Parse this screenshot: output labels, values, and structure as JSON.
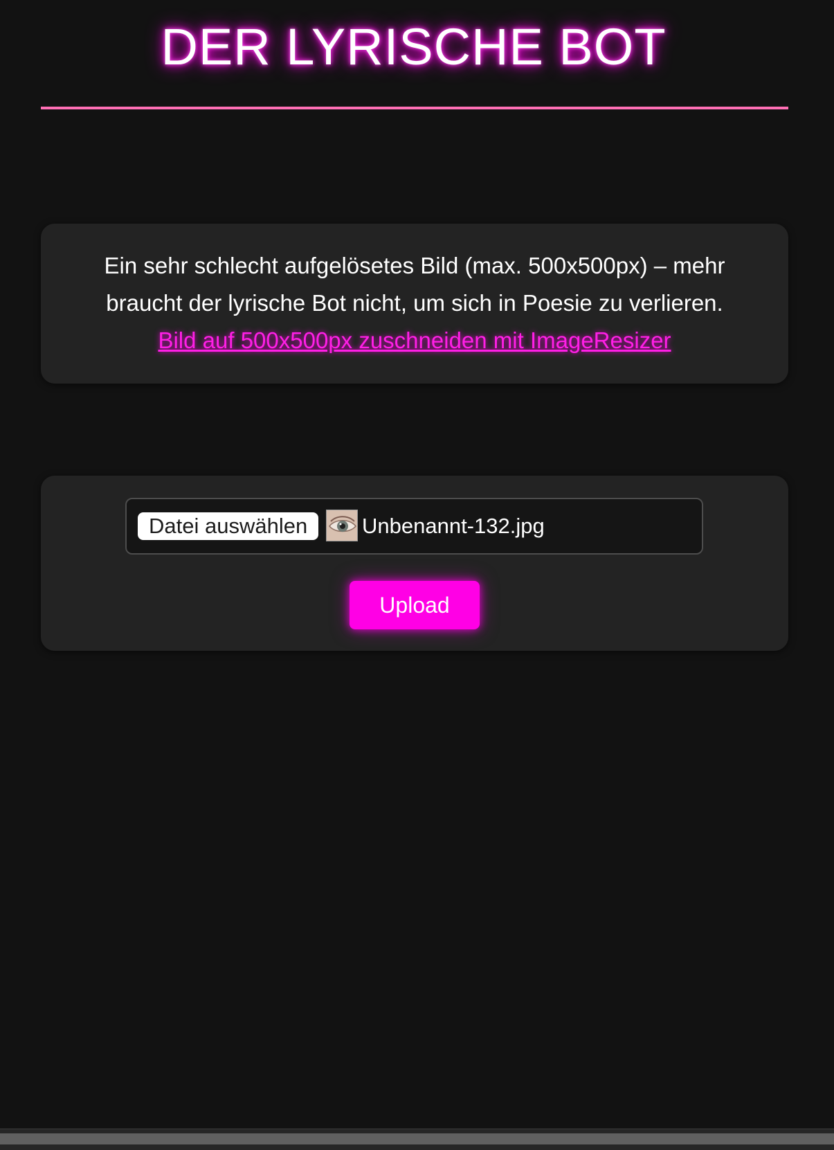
{
  "header": {
    "title": "DER LYRISCHE BOT"
  },
  "info": {
    "text": "Ein sehr schlecht aufgelösetes Bild (max. 500x500px) – mehr braucht der lyrische Bot nicht, um sich in Poesie zu verlieren.",
    "link_label": "Bild auf 500x500px zuschneiden mit ImageResizer"
  },
  "upload": {
    "choose_file_label": "Datei auswählen",
    "file_name": "Unbenannt-132.jpg",
    "thumbnail_icon": "eye-photo-thumbnail",
    "upload_label": "Upload"
  },
  "theme": {
    "accent": "#ff00e5",
    "divider": "#ff6fb5",
    "background": "#121212",
    "card": "#232323"
  }
}
